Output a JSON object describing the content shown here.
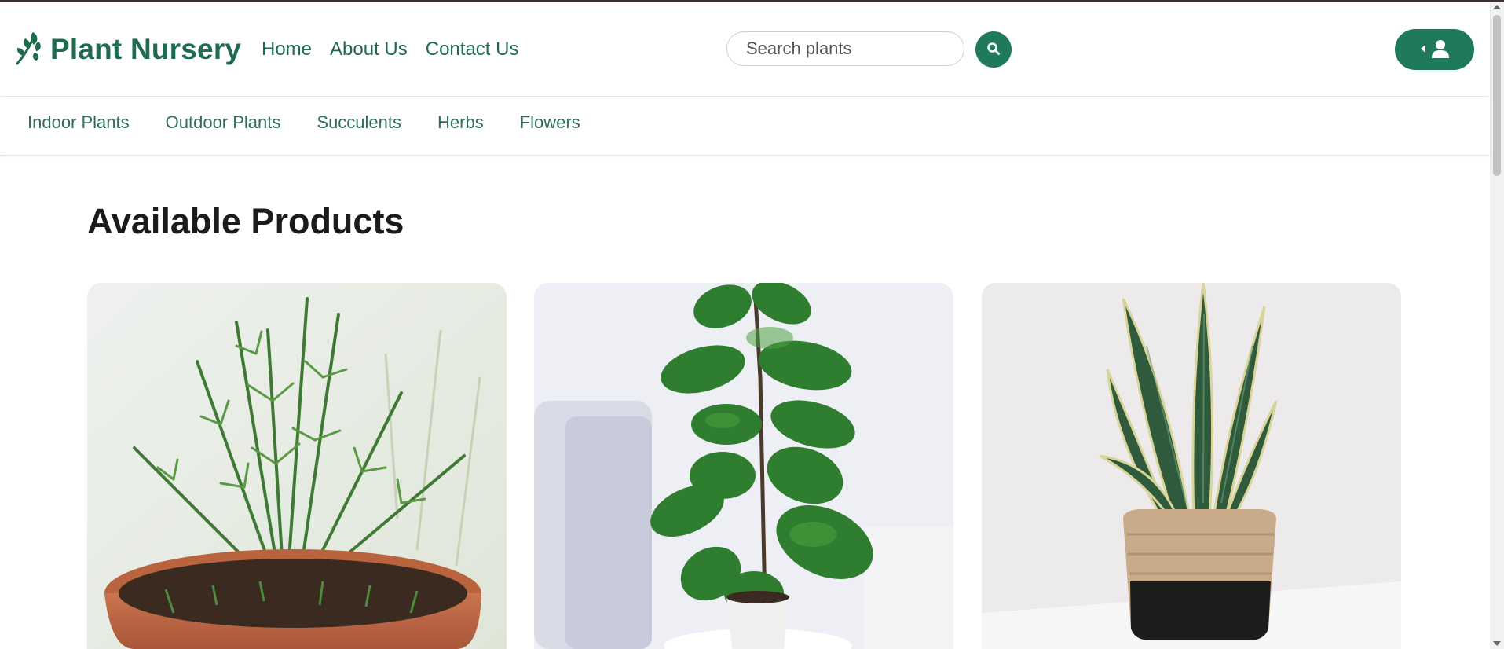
{
  "header": {
    "brand": "Plant Nursery",
    "nav": [
      "Home",
      "About Us",
      "Contact Us"
    ],
    "search": {
      "placeholder": "Search plants",
      "value": ""
    },
    "accent_color": "#1f7a5a"
  },
  "categories": [
    "Indoor Plants",
    "Outdoor Plants",
    "Succulents",
    "Herbs",
    "Flowers"
  ],
  "main": {
    "title": "Available Products",
    "products": [
      {
        "image": "rosemary-in-terracotta-pot"
      },
      {
        "image": "fiddle-leaf-fig-in-white-pot"
      },
      {
        "image": "snake-plant-in-woven-basket"
      }
    ]
  },
  "icons": {
    "logo": "leaf-icon",
    "search": "search-icon",
    "user": "user-icon",
    "caret": "caret-left-icon"
  }
}
